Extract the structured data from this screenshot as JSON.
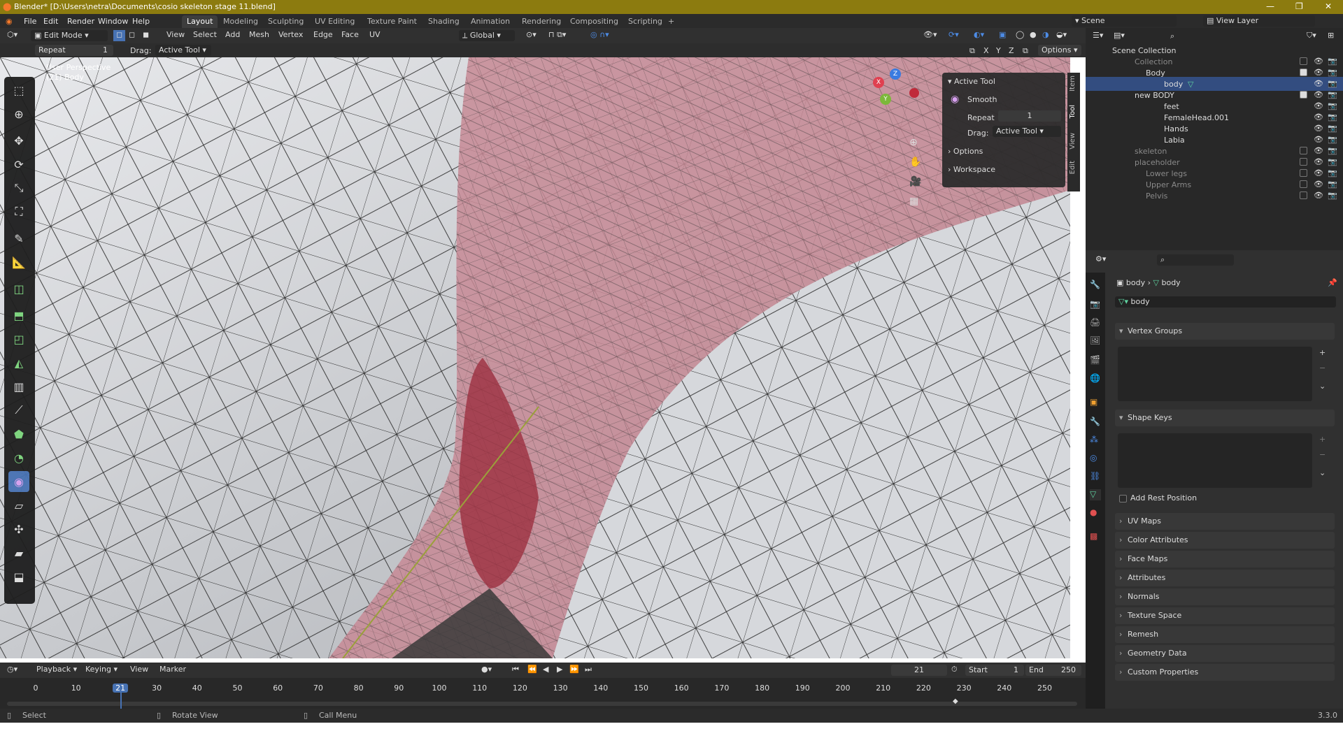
{
  "window": {
    "title": "Blender* [D:\\Users\\netra\\Documents\\cosio skeleton stage 11.blend]"
  },
  "menu": {
    "items": [
      "File",
      "Edit",
      "Render",
      "Window",
      "Help"
    ]
  },
  "workspaces": [
    "Layout",
    "Modeling",
    "Sculpting",
    "UV Editing",
    "Texture Paint",
    "Shading",
    "Animation",
    "Rendering",
    "Compositing",
    "Scripting",
    "+"
  ],
  "scene": {
    "label": "Scene",
    "view_layer": "View Layer"
  },
  "header": {
    "mode": "Edit Mode",
    "menus": [
      "View",
      "Select",
      "Add",
      "Mesh",
      "Vertex",
      "Edge",
      "Face",
      "UV"
    ],
    "orientation": "Global",
    "axes": [
      "X",
      "Y",
      "Z"
    ],
    "options": "Options"
  },
  "redo": {
    "repeat_label": "Repeat",
    "repeat_value": "1",
    "drag_label": "Drag:",
    "drag_value": "Active Tool"
  },
  "viewport": {
    "perspective": "User Perspective",
    "object": "(21) Body"
  },
  "npanel": {
    "section": "Active Tool",
    "tool_name": "Smooth",
    "repeat_label": "Repeat",
    "repeat_value": "1",
    "drag_label": "Drag:",
    "drag_value": "Active Tool",
    "options": "Options",
    "workspace": "Workspace",
    "tabs": [
      "Item",
      "Tool",
      "View",
      "Edit"
    ]
  },
  "gizmo": {
    "x": "X",
    "y": "Y",
    "z": "Z"
  },
  "outliner": {
    "scene_collection": "Scene Collection",
    "rows": [
      {
        "label": "Collection",
        "dim": true
      },
      {
        "label": "Body",
        "dim": false
      },
      {
        "label": "body",
        "dim": false
      },
      {
        "label": "new BODY",
        "dim": false
      },
      {
        "label": "feet",
        "dim": false
      },
      {
        "label": "FemaleHead.001",
        "dim": false
      },
      {
        "label": "Hands",
        "dim": false
      },
      {
        "label": "Labia",
        "dim": false
      },
      {
        "label": "skeleton",
        "dim": true
      },
      {
        "label": "placeholder",
        "dim": true
      },
      {
        "label": "Lower legs",
        "dim": true
      },
      {
        "label": "Upper Arms",
        "dim": true
      },
      {
        "label": "Pelvis",
        "dim": true
      }
    ]
  },
  "properties": {
    "breadcrumb_obj": "body",
    "breadcrumb_data": "body",
    "mesh_name": "body",
    "vertex_groups": "Vertex Groups",
    "shape_keys": "Shape Keys",
    "add_rest": "Add Rest Position",
    "sections": [
      "UV Maps",
      "Color Attributes",
      "Face Maps",
      "Attributes",
      "Normals",
      "Texture Space",
      "Remesh",
      "Geometry Data",
      "Custom Properties"
    ]
  },
  "timeline": {
    "menus": [
      "Playback",
      "Keying",
      "View",
      "Marker"
    ],
    "current": "21",
    "start_label": "Start",
    "start": "1",
    "end_label": "End",
    "end": "250",
    "ticks": [
      "0",
      "10",
      "21",
      "30",
      "40",
      "50",
      "60",
      "70",
      "80",
      "90",
      "100",
      "110",
      "120",
      "130",
      "140",
      "150",
      "160",
      "170",
      "180",
      "190",
      "200",
      "210",
      "220",
      "230",
      "240",
      "250"
    ]
  },
  "status": {
    "select": "Select",
    "rotate": "Rotate View",
    "call": "Call Menu",
    "version": "3.3.0"
  }
}
